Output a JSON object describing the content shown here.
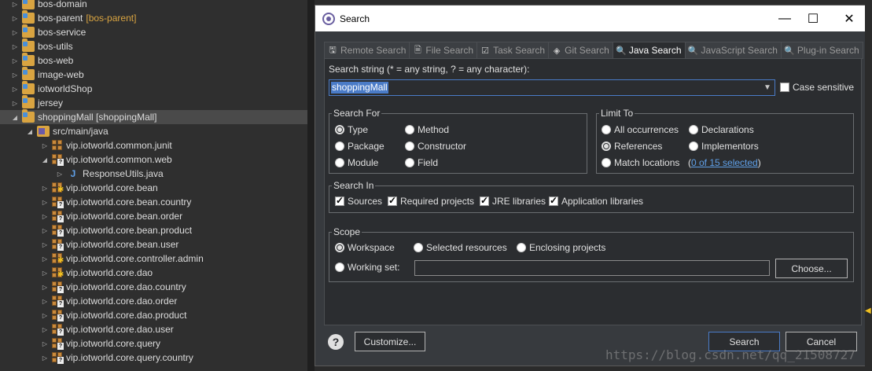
{
  "explorer": {
    "rows": [
      {
        "label": "bos-domain",
        "suffix": "",
        "arrow": "▷",
        "icon": "folder",
        "indent": 0
      },
      {
        "label": "bos-parent",
        "suffix": "[bos-parent]",
        "arrow": "▷",
        "icon": "folder",
        "indent": 0
      },
      {
        "label": "bos-service",
        "suffix": "",
        "arrow": "▷",
        "icon": "folder",
        "indent": 0
      },
      {
        "label": "bos-utils",
        "suffix": "",
        "arrow": "▷",
        "icon": "folder",
        "indent": 0
      },
      {
        "label": "bos-web",
        "suffix": "",
        "arrow": "▷",
        "icon": "folder",
        "indent": 0
      },
      {
        "label": "image-web",
        "suffix": "",
        "arrow": "▷",
        "icon": "folder",
        "indent": 0
      },
      {
        "label": "iotworldShop",
        "suffix": "",
        "arrow": "▷",
        "icon": "folder",
        "indent": 0
      },
      {
        "label": "jersey",
        "suffix": "",
        "arrow": "▷",
        "icon": "folder",
        "indent": 0
      },
      {
        "label": "shoppingMall [shoppingMall]",
        "suffix": "",
        "arrow": "◢",
        "icon": "folder",
        "indent": 0,
        "selected": true
      },
      {
        "label": "src/main/java",
        "suffix": "",
        "arrow": "◢",
        "icon": "srcfolder",
        "indent": 1
      },
      {
        "label": "vip.iotworld.common.junit",
        "suffix": "",
        "arrow": "▷",
        "icon": "pkg",
        "indent": 2
      },
      {
        "label": "vip.iotworld.common.web",
        "suffix": "",
        "arrow": "◢",
        "icon": "pkgq",
        "indent": 2
      },
      {
        "label": "ResponseUtils.java",
        "suffix": "",
        "arrow": "▷",
        "icon": "jfile",
        "indent": 3
      },
      {
        "label": "vip.iotworld.core.bean",
        "suffix": "",
        "arrow": "▷",
        "icon": "pkgstar",
        "indent": 2
      },
      {
        "label": "vip.iotworld.core.bean.country",
        "suffix": "",
        "arrow": "▷",
        "icon": "pkgq",
        "indent": 2
      },
      {
        "label": "vip.iotworld.core.bean.order",
        "suffix": "",
        "arrow": "▷",
        "icon": "pkgq",
        "indent": 2
      },
      {
        "label": "vip.iotworld.core.bean.product",
        "suffix": "",
        "arrow": "▷",
        "icon": "pkgq",
        "indent": 2
      },
      {
        "label": "vip.iotworld.core.bean.user",
        "suffix": "",
        "arrow": "▷",
        "icon": "pkgq",
        "indent": 2
      },
      {
        "label": "vip.iotworld.core.controller.admin",
        "suffix": "",
        "arrow": "▷",
        "icon": "pkgstar",
        "indent": 2
      },
      {
        "label": "vip.iotworld.core.dao",
        "suffix": "",
        "arrow": "▷",
        "icon": "pkgstar",
        "indent": 2
      },
      {
        "label": "vip.iotworld.core.dao.country",
        "suffix": "",
        "arrow": "▷",
        "icon": "pkgq",
        "indent": 2
      },
      {
        "label": "vip.iotworld.core.dao.order",
        "suffix": "",
        "arrow": "▷",
        "icon": "pkgq",
        "indent": 2
      },
      {
        "label": "vip.iotworld.core.dao.product",
        "suffix": "",
        "arrow": "▷",
        "icon": "pkgq",
        "indent": 2
      },
      {
        "label": "vip.iotworld.core.dao.user",
        "suffix": "",
        "arrow": "▷",
        "icon": "pkgq",
        "indent": 2
      },
      {
        "label": "vip.iotworld.core.query",
        "suffix": "",
        "arrow": "▷",
        "icon": "pkgq",
        "indent": 2
      },
      {
        "label": "vip.iotworld.core.query.country",
        "suffix": "",
        "arrow": "▷",
        "icon": "pkgq",
        "indent": 2
      }
    ]
  },
  "dialog": {
    "title": "Search",
    "window_buttons": {
      "minimize": "—",
      "maximize": "☐",
      "close": "✕"
    },
    "tabs": [
      {
        "label": "Remote Search",
        "icon": "remote-search-icon",
        "glyph": "🖫",
        "active": false
      },
      {
        "label": "File Search",
        "icon": "file-search-icon",
        "glyph": "🗎",
        "active": false
      },
      {
        "label": "Task Search",
        "icon": "task-search-icon",
        "glyph": "☑",
        "active": false
      },
      {
        "label": "Git Search",
        "icon": "git-search-icon",
        "glyph": "◈",
        "active": false
      },
      {
        "label": "Java Search",
        "icon": "java-search-icon",
        "glyph": "🔍",
        "active": true
      },
      {
        "label": "JavaScript Search",
        "icon": "javascript-search-icon",
        "glyph": "🔍",
        "active": false
      },
      {
        "label": "Plug-in Search",
        "icon": "plugin-search-icon",
        "glyph": "🔍",
        "active": false
      }
    ],
    "search_string_label": "Search string (* = any string, ? = any character):",
    "search_value": "shoppingMall",
    "case_sensitive_label": "Case sensitive",
    "search_for": {
      "title": "Search For",
      "options": [
        "Type",
        "Package",
        "Module",
        "Method",
        "Constructor",
        "Field"
      ],
      "selected": "Type"
    },
    "limit_to": {
      "title": "Limit To",
      "options": [
        "All occurrences",
        "References",
        "Match locations",
        "Declarations",
        "Implementors"
      ],
      "selected": "References",
      "match_link": "0 of 15 selected"
    },
    "search_in": {
      "title": "Search In",
      "options": [
        "Sources",
        "Required projects",
        "JRE libraries",
        "Application libraries"
      ]
    },
    "scope": {
      "title": "Scope",
      "options": [
        "Workspace",
        "Selected resources",
        "Enclosing projects"
      ],
      "selected": "Workspace",
      "working_set_label": "Working set:",
      "working_set_value": "",
      "choose_label": "Choose..."
    },
    "customize_label": "Customize...",
    "search_button": "Search",
    "cancel_button": "Cancel"
  },
  "watermark": "https://blog.csdn.net/qq_21508727"
}
